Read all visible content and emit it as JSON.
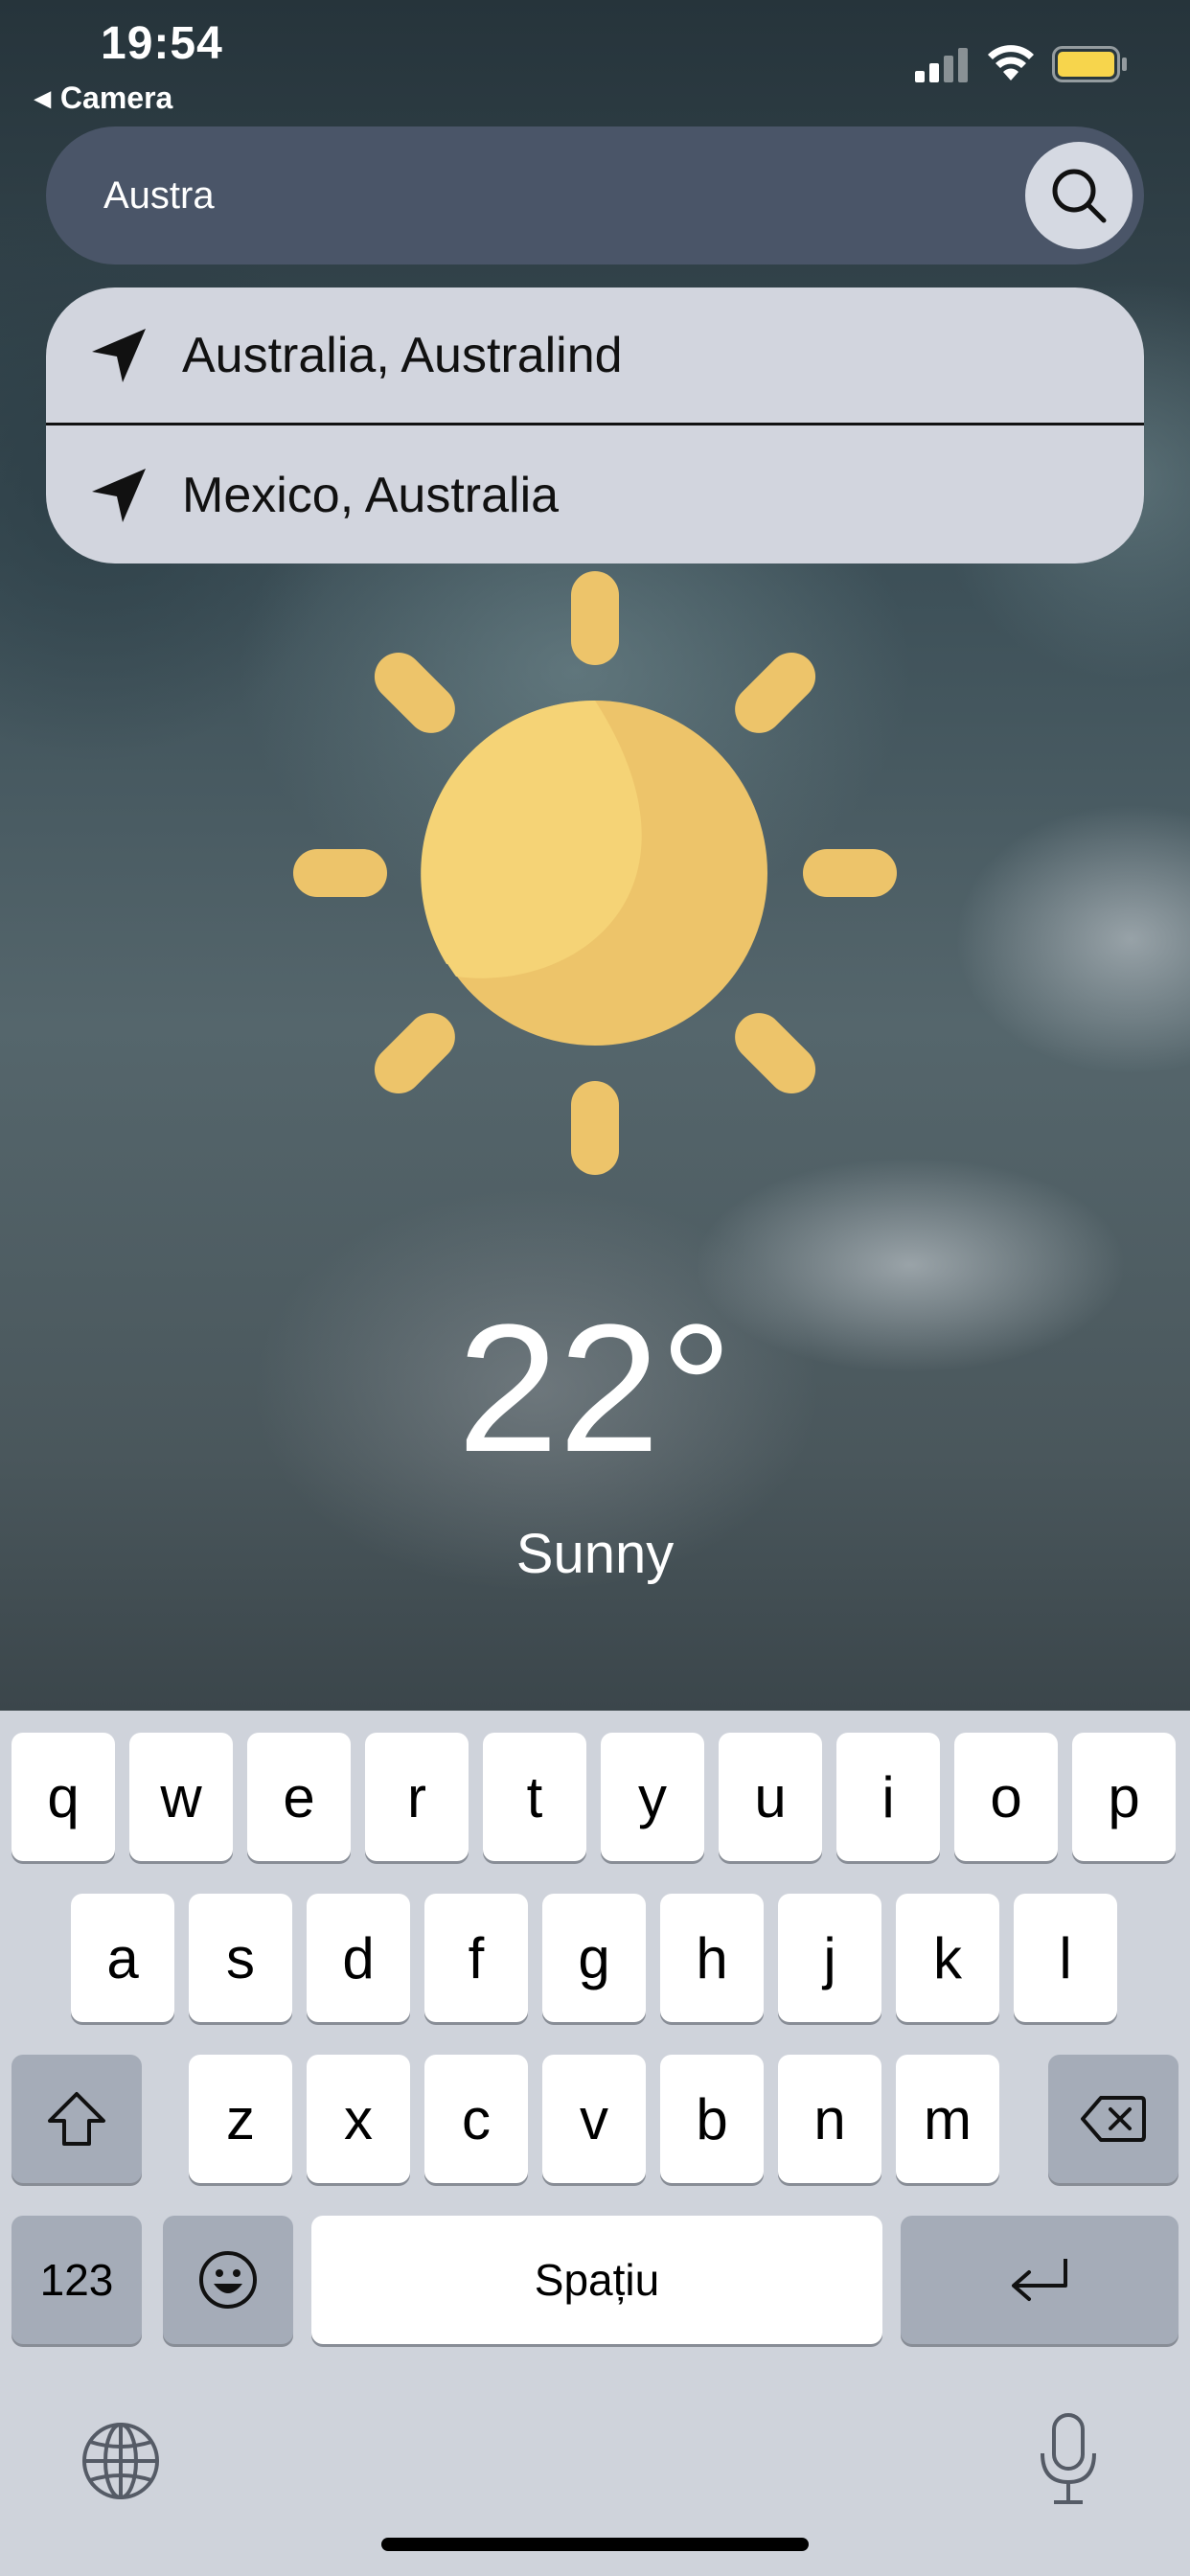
{
  "status_bar": {
    "time": "19:54",
    "back_app": "Camera",
    "back_icon": "back-triangle-icon"
  },
  "search": {
    "value": "Austra",
    "icon": "search-icon"
  },
  "suggestions": [
    {
      "label": "Australia, Australind",
      "icon": "location-arrow-icon"
    },
    {
      "label": "Mexico, Australia",
      "icon": "location-arrow-icon"
    }
  ],
  "weather": {
    "icon": "sun-icon",
    "temperature": "22°",
    "condition": "Sunny"
  },
  "keyboard": {
    "row1": [
      "q",
      "w",
      "e",
      "r",
      "t",
      "y",
      "u",
      "i",
      "o",
      "p"
    ],
    "row2": [
      "a",
      "s",
      "d",
      "f",
      "g",
      "h",
      "j",
      "k",
      "l"
    ],
    "row3": [
      "z",
      "x",
      "c",
      "v",
      "b",
      "n",
      "m"
    ],
    "numbers_label": "123",
    "space_label": "Spațiu",
    "shift_icon": "shift-icon",
    "delete_icon": "delete-icon",
    "emoji_icon": "emoji-icon",
    "return_icon": "return-icon",
    "globe_icon": "globe-icon",
    "mic_icon": "microphone-icon"
  },
  "colors": {
    "sun": "#F5D376",
    "sun_shade": "#EDC46A",
    "search_bar": "#4A5568",
    "suggestions_bg": "#D2D5DE",
    "battery": "#F7D54C"
  }
}
